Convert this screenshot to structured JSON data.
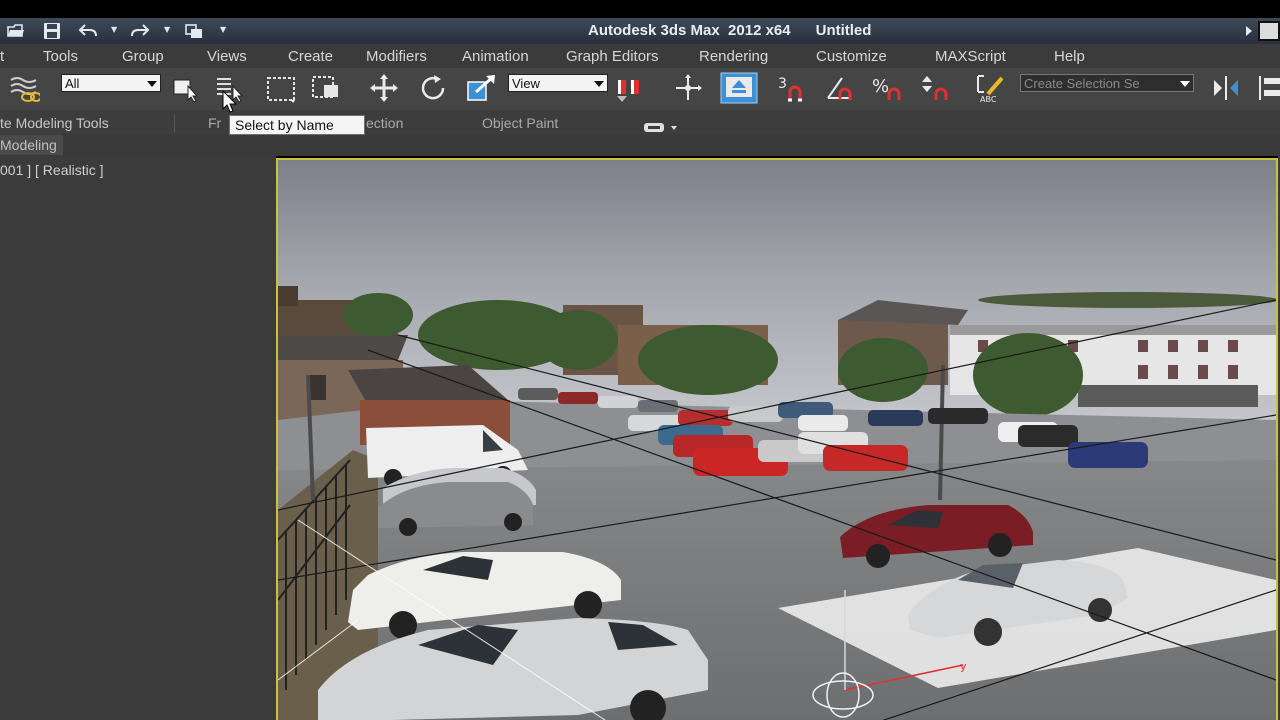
{
  "window": {
    "title": "Autodesk 3ds Max  2012 x64      Untitled"
  },
  "menu": [
    "t",
    "Tools",
    "Group",
    "Views",
    "Create",
    "Modifiers",
    "Animation",
    "Graph Editors",
    "Rendering",
    "Customize",
    "MAXScript",
    "Help"
  ],
  "toolbar": {
    "selection_filter": "All",
    "reference_coord": "View",
    "snap_toggle_label": "3",
    "named_selection_placeholder": "Create Selection Se"
  },
  "ribbon": {
    "tabs": [
      "te Modeling Tools",
      "Fr",
      "ection",
      "Object Paint"
    ],
    "panel_label": "Modeling"
  },
  "viewport": {
    "label": "001 ] [ Realistic ]",
    "gizmo_axis_label": "y"
  },
  "tooltip": {
    "text": "Select by Name"
  },
  "colors": {
    "viewport_border": "#c9c23f",
    "active_button": "#3d8fd6",
    "magnet_red": "#e23030"
  }
}
